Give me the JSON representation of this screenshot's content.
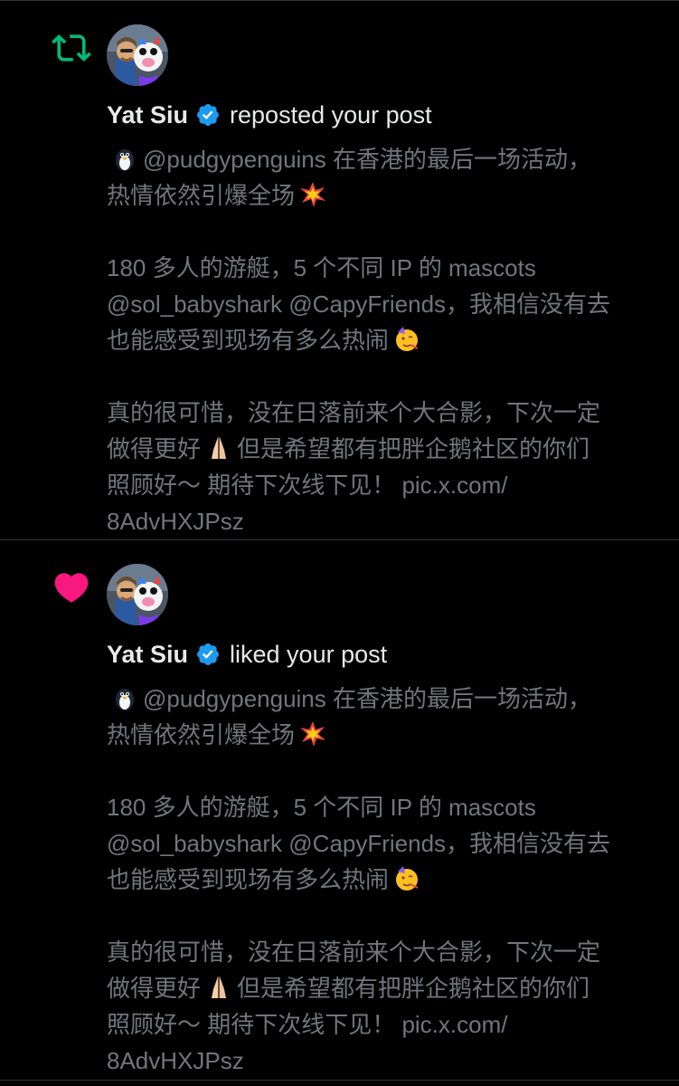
{
  "notifications": [
    {
      "type": "repost",
      "type_icon": "repost-icon",
      "icon_color": "#00ba7c",
      "actor": "Yat Siu",
      "verified_icon": "verified-badge-icon",
      "action": "reposted your post",
      "post": {
        "l1_handle": "@pudgypenguins",
        "l1_text": " 在香港的最后一场活动，",
        "l2_text": "热情依然引爆全场",
        "l3_text": "180 多人的游艇，5 个不同 IP 的 mascots",
        "l4_text": "@sol_babyshark @CapyFriends，我相信没有去",
        "l5_text": "也能感受到现场有多么热闹",
        "l6_text": "真的很可惜，没在日落前来个大合影，下次一定",
        "l7_a": "做得更好",
        "l7_b": "但是希望都有把胖企鹅社区的你们",
        "l8_text": "照顾好～ 期待下次线下见！ pic.x.com/",
        "l9_text": "8AdvHXJPsz"
      }
    },
    {
      "type": "like",
      "type_icon": "heart-icon",
      "icon_color": "#f91880",
      "actor": "Yat Siu",
      "verified_icon": "verified-badge-icon",
      "action": "liked your post",
      "post": {
        "l1_handle": "@pudgypenguins",
        "l1_text": " 在香港的最后一场活动，",
        "l2_text": "热情依然引爆全场",
        "l3_text": "180 多人的游艇，5 个不同 IP 的 mascots",
        "l4_text": "@sol_babyshark @CapyFriends，我相信没有去",
        "l5_text": "也能感受到现场有多么热闹",
        "l6_text": "真的很可惜，没在日落前来个大合影，下次一定",
        "l7_a": "做得更好",
        "l7_b": "但是希望都有把胖企鹅社区的你们",
        "l8_text": "照顾好～ 期待下次线下见！ pic.x.com/",
        "l9_text": "8AdvHXJPsz"
      }
    }
  ],
  "emoji_names": [
    "penguin-emoji",
    "collision-emoji",
    "partying-face-emoji",
    "folded-hands-emoji"
  ],
  "colors": {
    "background": "#000000",
    "primary_text": "#e7e9ea",
    "secondary_text": "#71767b",
    "verified_blue": "#1d9bf0",
    "divider": "#2f3336"
  }
}
